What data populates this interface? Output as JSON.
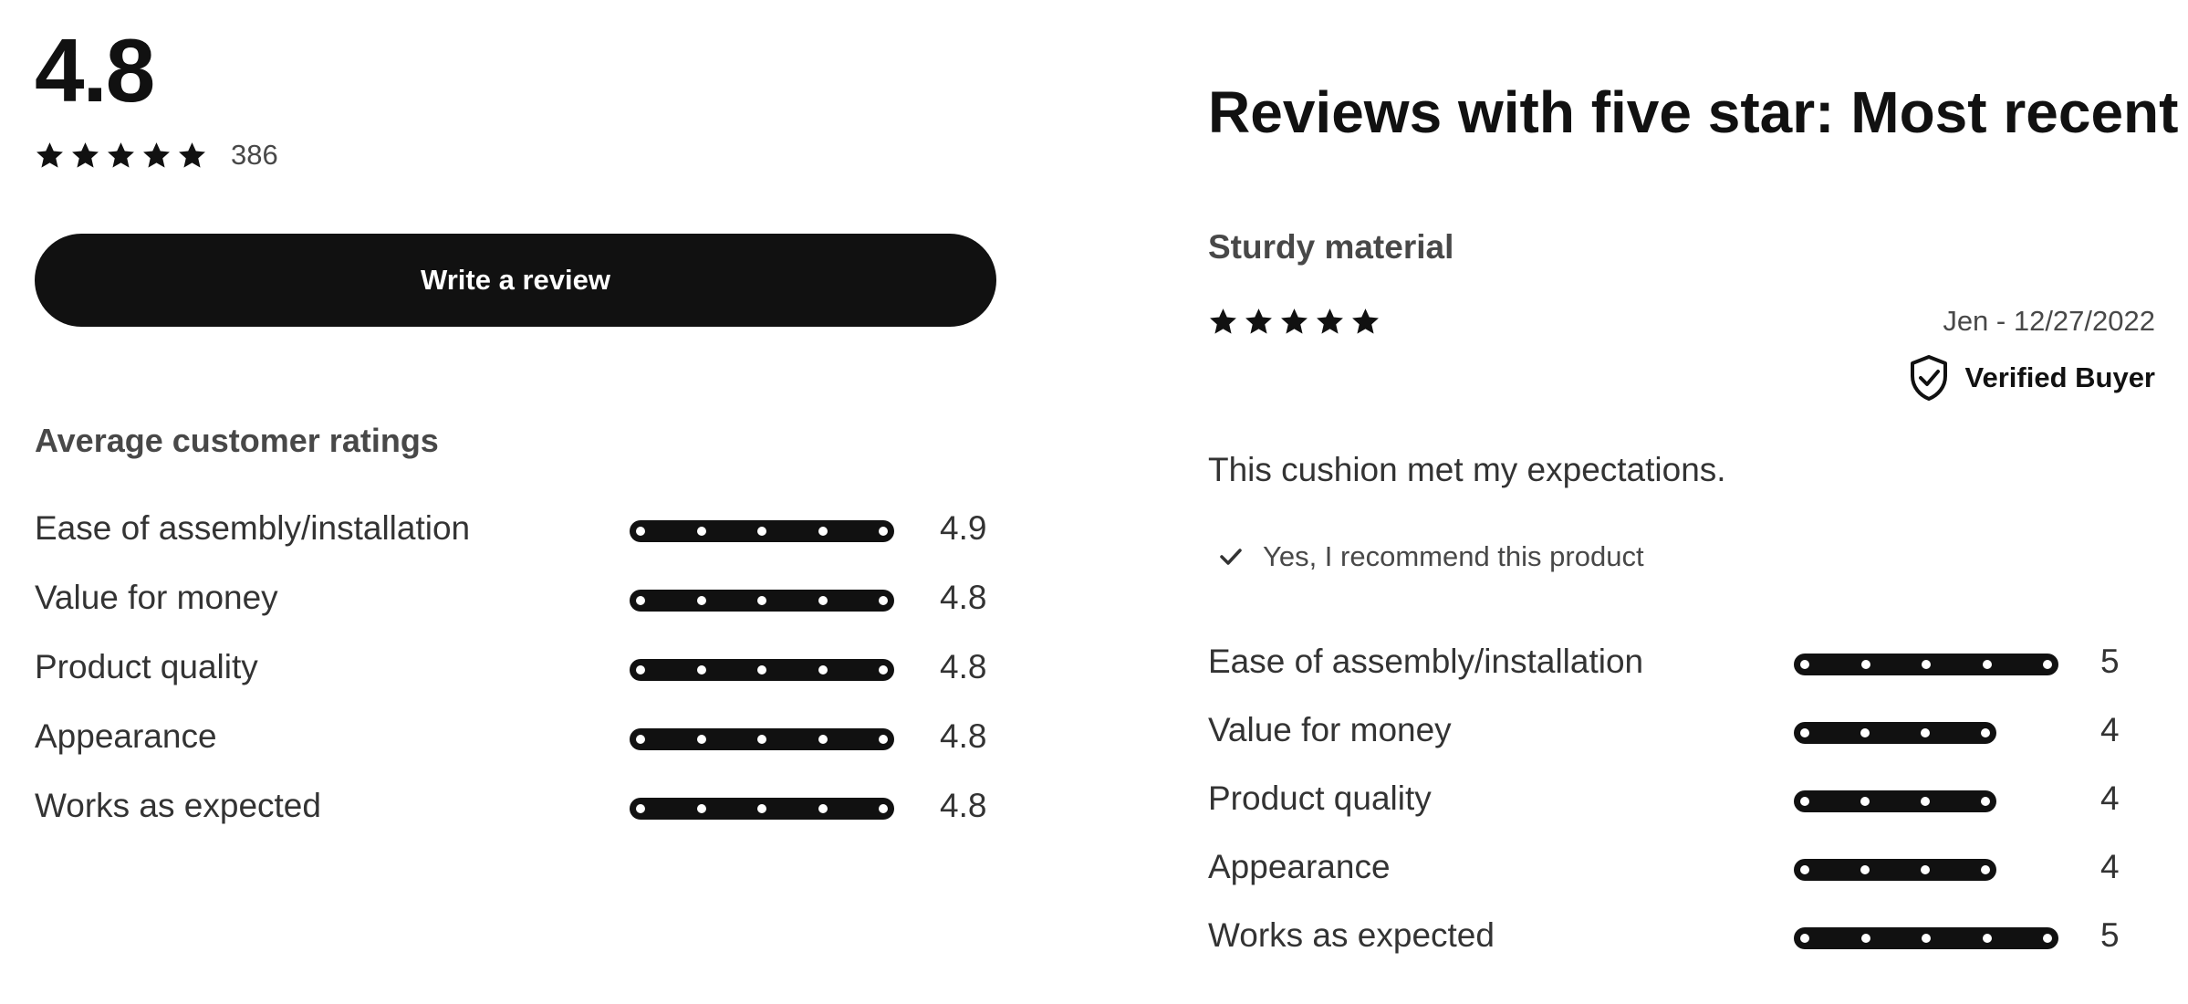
{
  "summary": {
    "average_score": "4.8",
    "review_count": "386",
    "stars_filled": 5,
    "stars_total": 5,
    "write_review_label": "Write a review"
  },
  "average_ratings": {
    "heading": "Average customer ratings",
    "scale_max": 5,
    "items": [
      {
        "label": "Ease of assembly/installation",
        "value": "4.9"
      },
      {
        "label": "Value for money",
        "value": "4.8"
      },
      {
        "label": "Product quality",
        "value": "4.8"
      },
      {
        "label": "Appearance",
        "value": "4.8"
      },
      {
        "label": "Works as expected",
        "value": "4.8"
      }
    ]
  },
  "reviews": {
    "heading": "Reviews with five star: Most recent",
    "review": {
      "title": "Sturdy material",
      "stars_filled": 5,
      "author_date": "Jen - 12/27/2022",
      "verified_label": "Verified Buyer",
      "text": "This cushion met my expectations.",
      "recommend_label": "Yes, I recommend this product",
      "ratings": [
        {
          "label": "Ease of assembly/installation",
          "value": "5"
        },
        {
          "label": "Value for money",
          "value": "4"
        },
        {
          "label": "Product quality",
          "value": "4"
        },
        {
          "label": "Appearance",
          "value": "4"
        },
        {
          "label": "Works as expected",
          "value": "5"
        }
      ]
    }
  },
  "colors": {
    "text_primary": "#111111",
    "text_secondary": "#484848",
    "bar": "#111111",
    "button_bg": "#111111",
    "button_text": "#ffffff"
  },
  "icons": {
    "star": "star-icon",
    "verified": "shield-check-icon",
    "recommend": "checkmark-icon"
  }
}
